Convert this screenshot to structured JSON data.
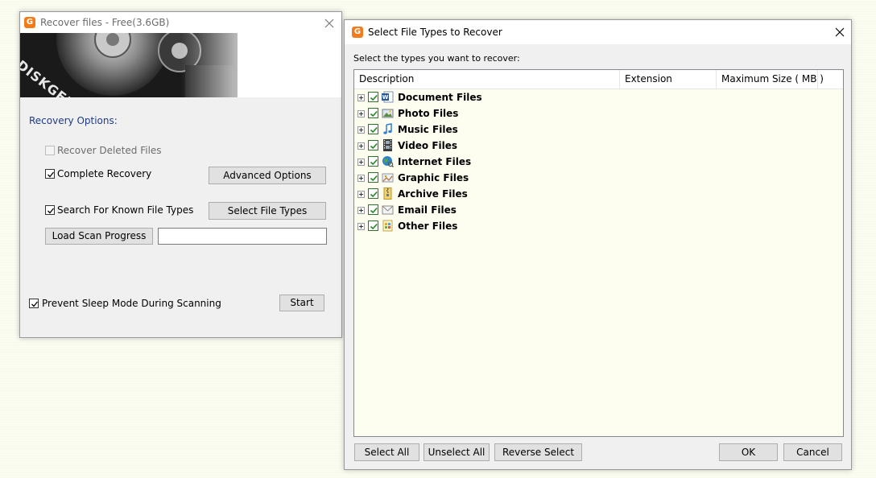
{
  "recover_window": {
    "title": "Recover files - Free(3.6GB)",
    "banner_text": "DISKGENIUS",
    "recovery_options_label": "Recovery Options:",
    "recover_deleted_label": "Recover Deleted Files",
    "complete_recovery_label": "Complete Recovery",
    "advanced_options_label": "Advanced Options",
    "search_known_label": "Search For Known File Types",
    "select_file_types_label": "Select File Types",
    "load_scan_progress_label": "Load Scan Progress",
    "scan_progress_value": "",
    "prevent_sleep_label": "Prevent Sleep Mode During Scanning",
    "start_label": "Start"
  },
  "types_dialog": {
    "title": "Select File Types to Recover",
    "instruction": "Select the types you want to recover:",
    "columns": [
      "Description",
      "Extension",
      "Maximum Size ( MB )"
    ],
    "items": [
      {
        "label": "Document Files",
        "icon": "word-document-icon"
      },
      {
        "label": "Photo Files",
        "icon": "photo-icon"
      },
      {
        "label": "Music Files",
        "icon": "music-note-icon"
      },
      {
        "label": "Video Files",
        "icon": "film-strip-icon"
      },
      {
        "label": "Internet Files",
        "icon": "globe-icon"
      },
      {
        "label": "Graphic Files",
        "icon": "graphic-icon"
      },
      {
        "label": "Archive Files",
        "icon": "archive-zip-icon"
      },
      {
        "label": "Email Files",
        "icon": "envelope-icon"
      },
      {
        "label": "Other Files",
        "icon": "other-file-icon"
      }
    ],
    "select_all_label": "Select All",
    "unselect_all_label": "Unselect All",
    "reverse_select_label": "Reverse Select",
    "ok_label": "OK",
    "cancel_label": "Cancel"
  },
  "colors": {
    "brand_orange": "#f27c1c",
    "check_green": "#2a7a2a",
    "list_background": "#fefef0",
    "options_label_blue": "#1e3a8a"
  }
}
